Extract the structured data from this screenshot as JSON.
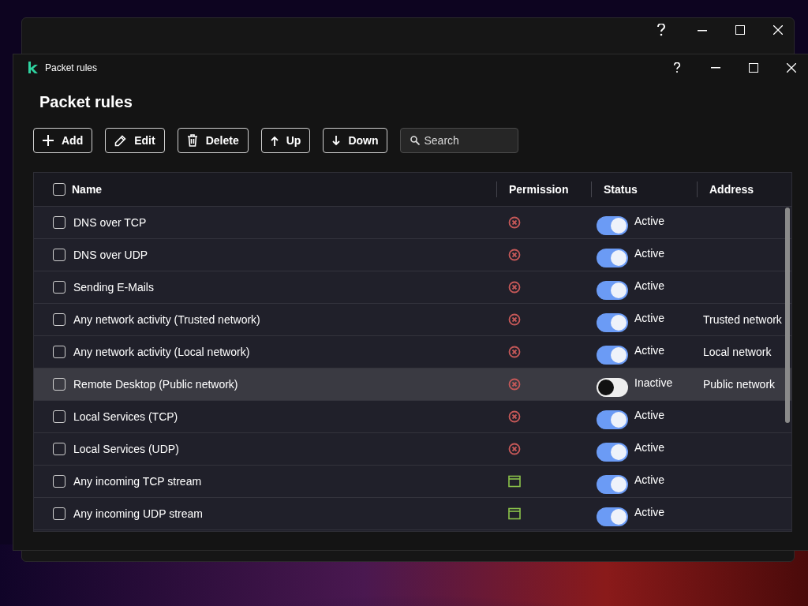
{
  "window": {
    "title": "Packet rules"
  },
  "heading": "Packet rules",
  "toolbar": [
    {
      "kind": "add",
      "label": "Add"
    },
    {
      "kind": "edit",
      "label": "Edit"
    },
    {
      "kind": "delete",
      "label": "Delete"
    },
    {
      "kind": "up",
      "label": "Up"
    },
    {
      "kind": "down",
      "label": "Down"
    }
  ],
  "search": {
    "placeholder": "Search"
  },
  "table": {
    "columns": [
      "Name",
      "Permission",
      "Status",
      "Address"
    ],
    "header_checked": false,
    "rows": [
      {
        "name": "DNS over TCP",
        "checked": false,
        "kind": "block",
        "active": true,
        "status": "Active",
        "highlighted": false
      },
      {
        "name": "DNS over UDP",
        "checked": false,
        "kind": "block",
        "active": true,
        "status": "Active",
        "highlighted": false
      },
      {
        "name": "Sending E-Mails",
        "checked": false,
        "kind": "block",
        "active": true,
        "status": "Active",
        "highlighted": false
      },
      {
        "name": "Any network activity (Trusted network)",
        "checked": false,
        "kind": "block",
        "active": true,
        "status": "Active",
        "address": "Trusted network",
        "highlighted": false
      },
      {
        "name": "Any network activity (Local network)",
        "checked": false,
        "kind": "block",
        "active": true,
        "status": "Active",
        "address": "Local network",
        "highlighted": false
      },
      {
        "name": "Remote Desktop (Public network)",
        "checked": false,
        "kind": "block",
        "active": false,
        "status": "Inactive",
        "address": "Public network",
        "highlighted": true
      },
      {
        "name": "Local Services (TCP)",
        "checked": false,
        "kind": "block",
        "active": true,
        "status": "Active",
        "highlighted": false
      },
      {
        "name": "Local Services (UDP)",
        "checked": false,
        "kind": "block",
        "active": true,
        "status": "Active",
        "highlighted": false
      },
      {
        "name": "Any incoming TCP stream",
        "checked": false,
        "kind": "app",
        "active": true,
        "status": "Active",
        "highlighted": false
      },
      {
        "name": "Any incoming UDP stream",
        "checked": false,
        "kind": "app",
        "active": true,
        "status": "Active",
        "highlighted": false
      }
    ]
  }
}
